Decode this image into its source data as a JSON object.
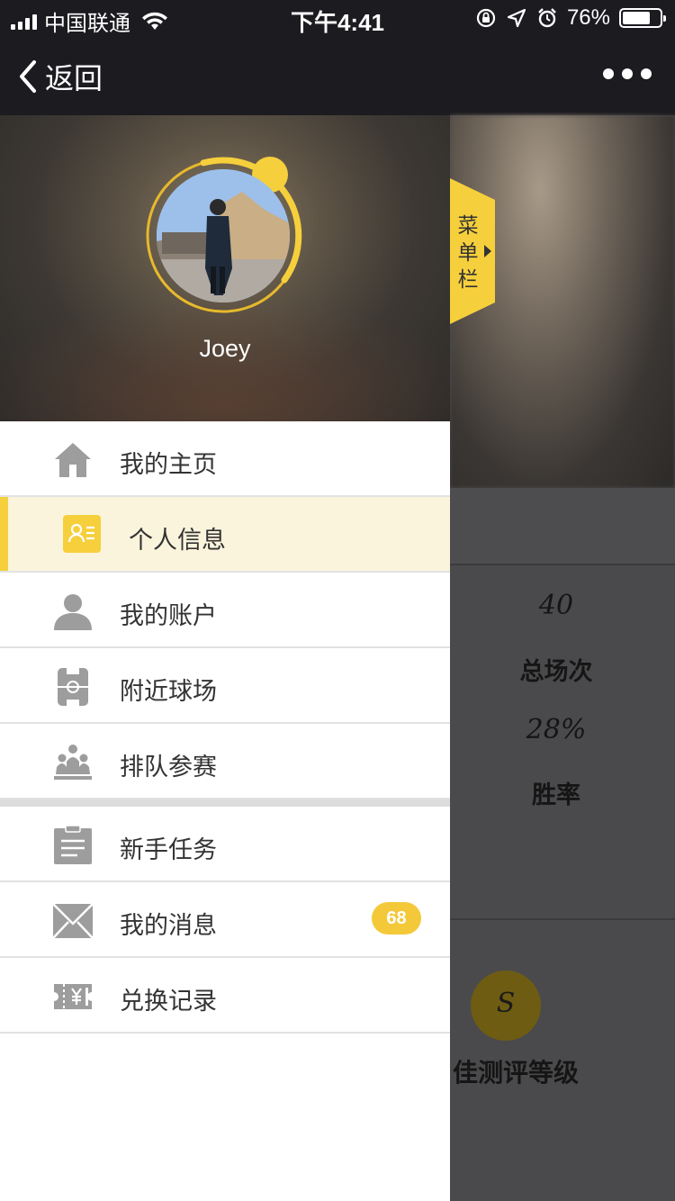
{
  "status_bar": {
    "carrier": "中国联通",
    "time": "下午4:41",
    "battery": "76%",
    "battery_level": 0.76
  },
  "nav": {
    "back_label": "返回"
  },
  "profile": {
    "username": "Joey"
  },
  "menu_tab": {
    "label": "菜单栏"
  },
  "menu": {
    "items": [
      {
        "label": "我的主页",
        "icon": "home-icon"
      },
      {
        "label": "个人信息",
        "icon": "id-card-icon",
        "active": true
      },
      {
        "label": "我的账户",
        "icon": "user-icon"
      },
      {
        "label": "附近球场",
        "icon": "field-icon"
      },
      {
        "label": "排队参赛",
        "icon": "team-icon"
      },
      {
        "label": "新手任务",
        "icon": "clipboard-icon"
      },
      {
        "label": "我的消息",
        "icon": "mail-icon",
        "badge": "68"
      },
      {
        "label": "兑换记录",
        "icon": "ticket-icon"
      }
    ]
  },
  "background_page": {
    "total_games_value": "40",
    "total_games_label": "总场次",
    "win_rate_value": "28%",
    "win_rate_label": "胜率",
    "grade_value": "S",
    "grade_label": "佳测评等级"
  },
  "colors": {
    "accent": "#f6cf3c",
    "active_row": "#fbf4dc",
    "bar": "#1b1b20"
  }
}
